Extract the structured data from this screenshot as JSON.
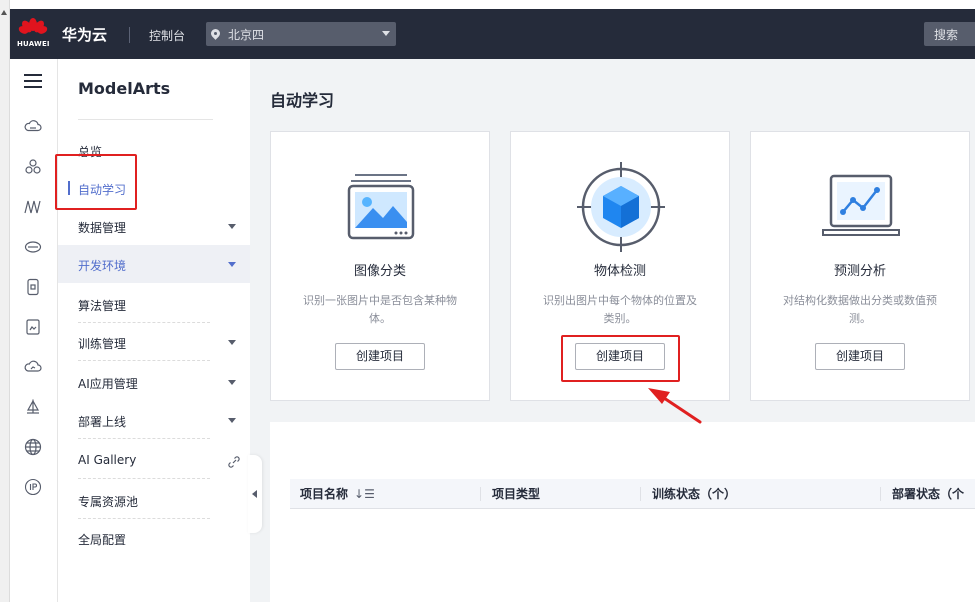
{
  "topbar": {
    "logo_text": "HUAWEI",
    "brand": "华为云",
    "console_label": "控制台",
    "region": "北京四",
    "search_label": "搜索"
  },
  "icon_rail": {
    "icons": [
      "menu-icon",
      "cloud-storage-icon",
      "cluster-icon",
      "waveform-icon",
      "disk-icon",
      "mobile-icon",
      "image-icon",
      "cloud-monitor-icon",
      "sail-icon",
      "globe-icon",
      "ip-icon"
    ]
  },
  "sidenav": {
    "title": "ModelArts",
    "items": [
      {
        "label": "总览"
      },
      {
        "label": "自动学习"
      },
      {
        "label": "数据管理"
      },
      {
        "label": "开发环境"
      },
      {
        "label": "算法管理"
      },
      {
        "label": "训练管理"
      },
      {
        "label": "AI应用管理"
      },
      {
        "label": "部署上线"
      },
      {
        "label": "AI Gallery"
      },
      {
        "label": "专属资源池"
      },
      {
        "label": "全局配置"
      }
    ]
  },
  "main": {
    "page_title": "自动学习",
    "cards": [
      {
        "title": "图像分类",
        "desc": "识别一张图片中是否包含某种物体。",
        "button": "创建项目"
      },
      {
        "title": "物体检测",
        "desc": "识别出图片中每个物体的位置及类别。",
        "button": "创建项目"
      },
      {
        "title": "预测分析",
        "desc": "对结构化数据做出分类或数值预测。",
        "button": "创建项目"
      }
    ],
    "table": {
      "columns": [
        "项目名称",
        "项目类型",
        "训练状态（个）",
        "部署状态（个"
      ]
    }
  },
  "colors": {
    "topbar": "#252b3a",
    "accent": "#526ecc",
    "annotation": "#e02020",
    "brand_red": "#e0141e"
  }
}
